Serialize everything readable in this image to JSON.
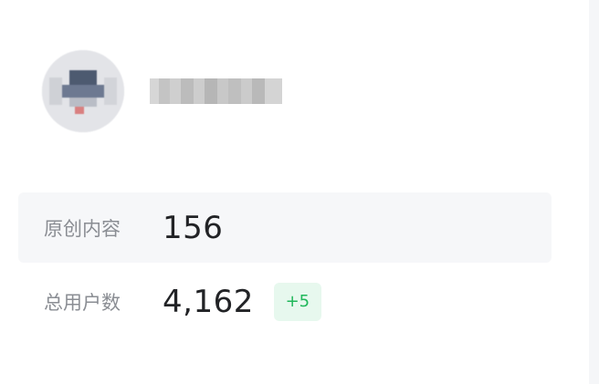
{
  "user": {
    "name": "████████",
    "avatar_icon": "user-avatar"
  },
  "stats": [
    {
      "label": "原创内容",
      "value": "156"
    },
    {
      "label": "总用户数",
      "value": "4,162",
      "change": "+5"
    }
  ],
  "colors": {
    "highlight_row_bg": "#f6f7f9",
    "badge_bg": "#e7f8ee",
    "badge_text": "#1fb75a",
    "label_text": "#8a8d93",
    "value_text": "#222326"
  }
}
